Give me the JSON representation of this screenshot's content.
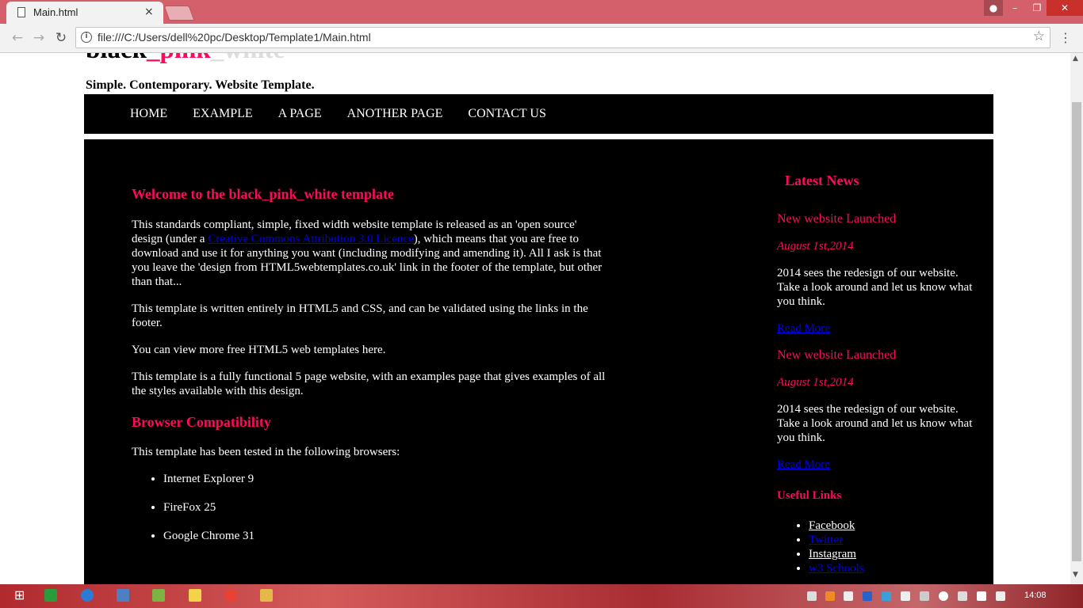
{
  "browser": {
    "tab_title": "Main.html",
    "tab_close": "×",
    "url": "file:///C:/Users/dell%20pc/Desktop/Template1/Main.html",
    "back_glyph": "←",
    "forward_glyph": "→",
    "reload_glyph": "↻",
    "info_glyph": "i",
    "star_glyph": "☆",
    "menu_glyph": "⋮",
    "minimize_glyph": "–",
    "maximize_glyph": "❐",
    "close_glyph": "✕",
    "user_glyph": "●"
  },
  "site": {
    "logo_black": "black",
    "logo_pink": "_pink",
    "logo_white": "_white",
    "slogan": "Simple. Contemporary. Website Template.",
    "menu": [
      "HOME",
      "EXAMPLE",
      "A PAGE",
      "ANOTHER PAGE",
      "CONTACT US"
    ]
  },
  "content": {
    "heading": "Welcome to the black_pink_white template",
    "p1_before": "This standards compliant, simple, fixed width website template is released as an 'open source' design (under a ",
    "p1_link": "Creative Commons Attribution 3.0 Licence",
    "p1_after": "), which means that you are free to download and use it for anything you want (including modifying and amending it). All I ask is that you leave the 'design from HTML5webtemplates.co.uk' link in the footer of the template, but other than that...",
    "p2": "This template is written entirely in HTML5 and CSS, and can be validated using the links in the footer.",
    "p3": "You can view more free HTML5 web templates here.",
    "p4": "This template is a fully functional 5 page website, with an examples page that gives examples of all the styles available with this design.",
    "compat_heading": "Browser Compatibility",
    "compat_intro": "This template has been tested in the following browsers:",
    "browsers": [
      "Internet Explorer 9",
      "FireFox 25",
      "Google Chrome 31"
    ]
  },
  "sidebar": {
    "news_heading": "Latest News",
    "news": [
      {
        "title": "New website Launched",
        "date": "August 1st,2014",
        "text": "2014 sees the redesign of our website. Take a look around and let us know what you think.",
        "link": "Read More"
      },
      {
        "title": "New website Launched",
        "date": "August 1st,2014",
        "text": "2014 sees the redesign of our website. Take a look around and let us know what you think.",
        "link": "Read More"
      }
    ],
    "links_heading": "Useful Links",
    "links": [
      "Facebook",
      "Twitter",
      "Instagram",
      "w3 Schools"
    ]
  },
  "taskbar": {
    "clock": "14:08",
    "start_glyph": "⊞"
  },
  "colors": {
    "accent_pink": "#ff0a5a",
    "link_blue": "#0000ee",
    "chrome_titlebar": "#d3606a"
  }
}
